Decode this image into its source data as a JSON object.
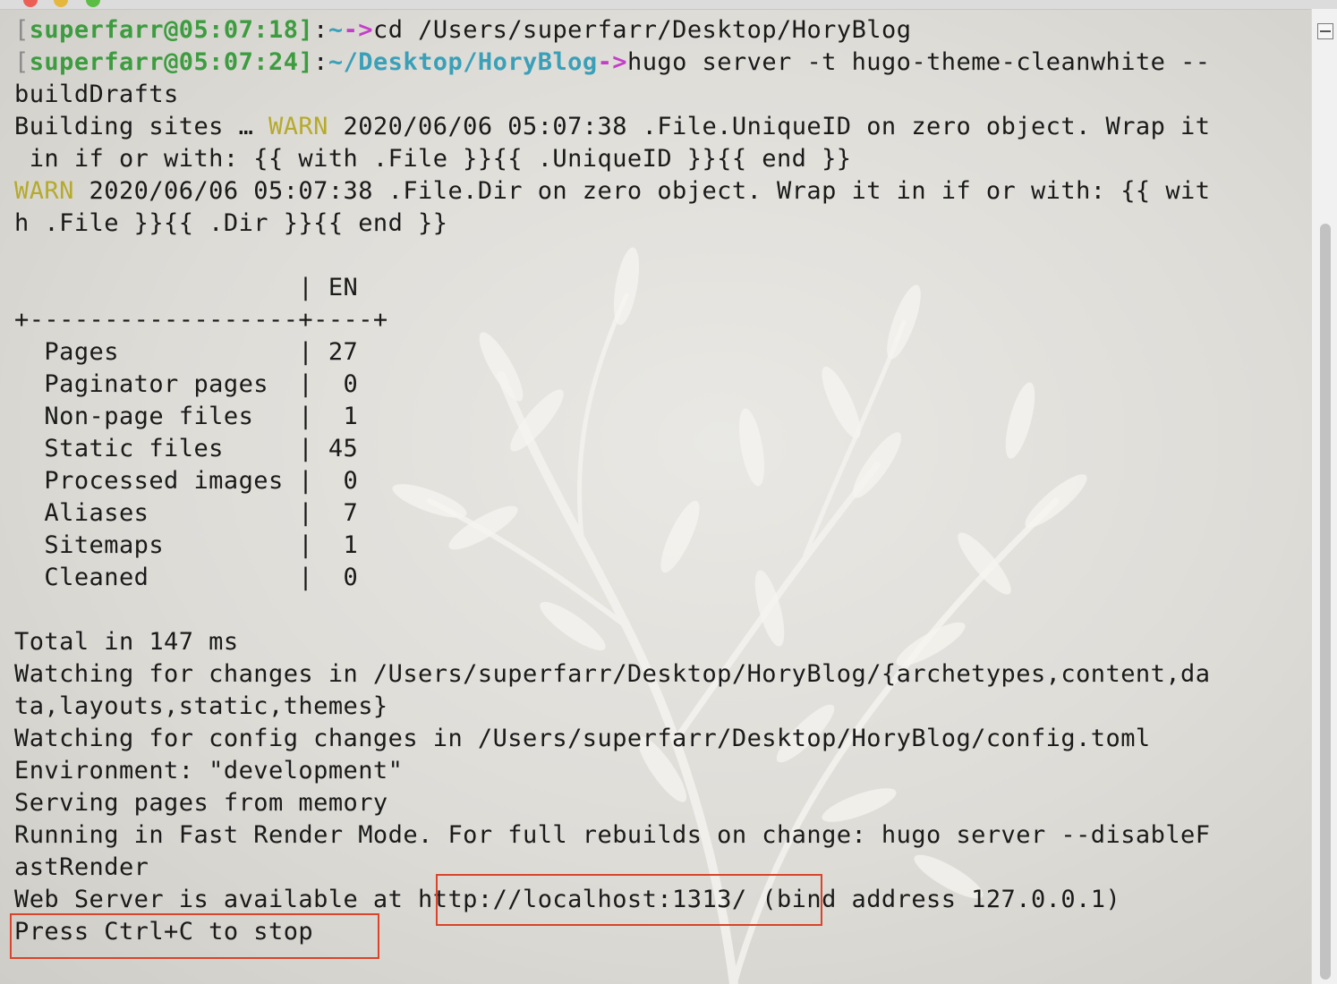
{
  "terminal": {
    "lines": [
      {
        "type": "prompt",
        "open": "[",
        "user": "superfarr@05:07:18",
        "close": "]",
        "colon": ":",
        "path": "~",
        "arrow": "->",
        "cmd": "cd /Users/superfarr/Desktop/HoryBlog"
      },
      {
        "type": "prompt",
        "open": "[",
        "user": "superfarr@05:07:24",
        "close": "]",
        "colon": ":",
        "path": "~/Desktop/HoryBlog",
        "arrow": "->",
        "cmd": "hugo server -t hugo-theme-cleanwhite --"
      },
      {
        "type": "text",
        "text": "buildDrafts"
      },
      {
        "type": "warn",
        "pre": "Building sites … ",
        "tag": "WARN",
        "post": " 2020/06/06 05:07:38 .File.UniqueID on zero object. Wrap it"
      },
      {
        "type": "text",
        "text": " in if or with: {{ with .File }}{{ .UniqueID }}{{ end }}"
      },
      {
        "type": "warn",
        "pre": "",
        "tag": "WARN",
        "post": " 2020/06/06 05:07:38 .File.Dir on zero object. Wrap it in if or with: {{ wit"
      },
      {
        "type": "text",
        "text": "h .File }}{{ .Dir }}{{ end }}"
      },
      {
        "type": "text",
        "text": ""
      },
      {
        "type": "text",
        "text": "                   | EN"
      },
      {
        "type": "text",
        "text": "+------------------+----+"
      },
      {
        "type": "text",
        "text": "  Pages            | 27"
      },
      {
        "type": "text",
        "text": "  Paginator pages  |  0"
      },
      {
        "type": "text",
        "text": "  Non-page files   |  1"
      },
      {
        "type": "text",
        "text": "  Static files     | 45"
      },
      {
        "type": "text",
        "text": "  Processed images |  0"
      },
      {
        "type": "text",
        "text": "  Aliases          |  7"
      },
      {
        "type": "text",
        "text": "  Sitemaps         |  1"
      },
      {
        "type": "text",
        "text": "  Cleaned          |  0"
      },
      {
        "type": "text",
        "text": ""
      },
      {
        "type": "text",
        "text": "Total in 147 ms"
      },
      {
        "type": "text",
        "text": "Watching for changes in /Users/superfarr/Desktop/HoryBlog/{archetypes,content,da"
      },
      {
        "type": "text",
        "text": "ta,layouts,static,themes}"
      },
      {
        "type": "text",
        "text": "Watching for config changes in /Users/superfarr/Desktop/HoryBlog/config.toml"
      },
      {
        "type": "text",
        "text": "Environment: \"development\""
      },
      {
        "type": "text",
        "text": "Serving pages from memory"
      },
      {
        "type": "text",
        "text": "Running in Fast Render Mode. For full rebuilds on change: hugo server --disableF"
      },
      {
        "type": "text",
        "text": "astRender"
      },
      {
        "type": "text",
        "text": "Web Server is available at http://localhost:1313/ (bind address 127.0.0.1)"
      },
      {
        "type": "text",
        "text": "Press Ctrl+C to stop"
      }
    ]
  },
  "colors": {
    "prompt_user": "#3c9c3f",
    "prompt_path": "#3aa0b8",
    "prompt_arrow": "#c43fc9",
    "warn": "#b6aa2c",
    "highlight_box": "#d9442a"
  },
  "icons": [
    "split-pane-icon"
  ]
}
